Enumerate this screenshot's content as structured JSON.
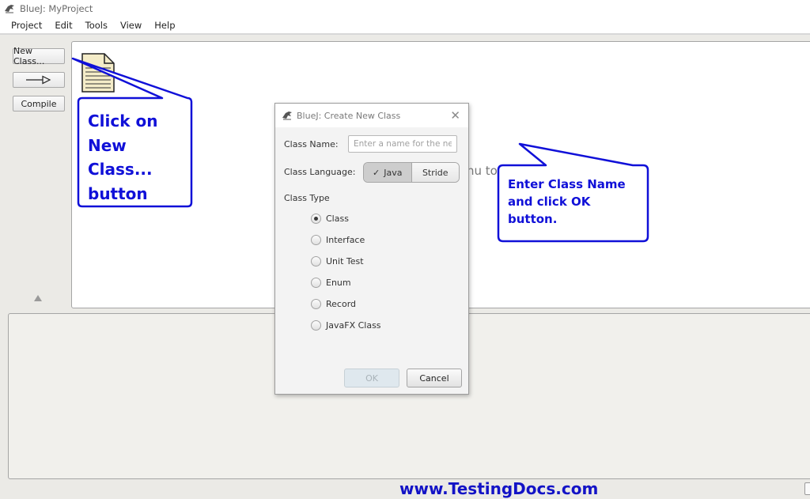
{
  "window": {
    "title": "BlueJ:  MyProject"
  },
  "menu": {
    "items": [
      "Project",
      "Edit",
      "Tools",
      "View",
      "Help"
    ]
  },
  "toolbar": {
    "new_class": "New Class...",
    "arrow": "—▷",
    "compile": "Compile"
  },
  "background_text": "nu to",
  "callouts": {
    "left": [
      "Click on",
      "New",
      "Class...",
      "button"
    ],
    "right": [
      "Enter Class Name",
      "and click OK",
      "button."
    ]
  },
  "dialog": {
    "title": "BlueJ:  Create New Class",
    "class_name_label": "Class Name:",
    "class_name_placeholder": "Enter a name for the new class",
    "class_name_value": "",
    "language_label": "Class Language:",
    "languages": [
      "Java",
      "Stride"
    ],
    "selected_language": "Java",
    "class_type_label": "Class Type",
    "class_types": [
      "Class",
      "Interface",
      "Unit Test",
      "Enum",
      "Record",
      "JavaFX Class"
    ],
    "selected_type": "Class",
    "ok": "OK",
    "cancel": "Cancel"
  },
  "footer": "www.TestingDocs.com",
  "colors": {
    "callout": "#1010d8",
    "footer": "#1313c6"
  }
}
